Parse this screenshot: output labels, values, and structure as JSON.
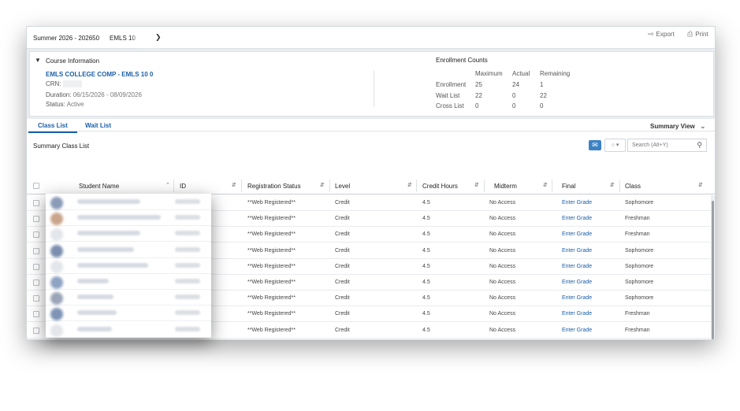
{
  "topbar": {
    "term": "Summer 2026 - 202650",
    "course": "EMLS 10",
    "export_label": "Export",
    "print_label": "Print"
  },
  "course_info": {
    "heading": "Course Information",
    "course_title": "EMLS COLLEGE COMP - EMLS 10 0",
    "crn_label": "CRN:",
    "duration_label": "Duration:",
    "duration_value": "06/15/2026 - 08/09/2026",
    "status_label": "Status:",
    "status_value": "Active"
  },
  "enrollment": {
    "heading": "Enrollment Counts",
    "col_headers": [
      "Maximum",
      "Actual",
      "Remaining"
    ],
    "rows": [
      {
        "label": "Enrollment",
        "values": [
          "25",
          "24",
          "1"
        ]
      },
      {
        "label": "Wait List",
        "values": [
          "22",
          "0",
          "22"
        ]
      },
      {
        "label": "Cross List",
        "values": [
          "0",
          "0",
          "0"
        ]
      }
    ]
  },
  "tabs": {
    "class_list": "Class List",
    "wait_list": "Wait List",
    "summary_view": "Summary View"
  },
  "toolbar": {
    "section_title": "Summary Class List",
    "search_placeholder": "Search (Alt+Y)"
  },
  "table": {
    "headers": [
      "Student Name",
      "ID",
      "Registration Status",
      "Level",
      "Credit Hours",
      "Midterm",
      "Final",
      "Class"
    ],
    "rows": [
      {
        "status": "**Web Registered**",
        "level": "Credit",
        "hours": "4.5",
        "midterm": "No Access",
        "final": "Enter Grade",
        "class": "Sophomore"
      },
      {
        "status": "**Web Registered**",
        "level": "Credit",
        "hours": "4.5",
        "midterm": "No Access",
        "final": "Enter Grade",
        "class": "Freshman"
      },
      {
        "status": "**Web Registered**",
        "level": "Credit",
        "hours": "4.5",
        "midterm": "No Access",
        "final": "Enter Grade",
        "class": "Freshman"
      },
      {
        "status": "**Web Registered**",
        "level": "Credit",
        "hours": "4.5",
        "midterm": "No Access",
        "final": "Enter Grade",
        "class": "Sophomore"
      },
      {
        "status": "**Web Registered**",
        "level": "Credit",
        "hours": "4.5",
        "midterm": "No Access",
        "final": "Enter Grade",
        "class": "Sophomore"
      },
      {
        "status": "**Web Registered**",
        "level": "Credit",
        "hours": "4.5",
        "midterm": "No Access",
        "final": "Enter Grade",
        "class": "Sophomore"
      },
      {
        "status": "**Web Registered**",
        "level": "Credit",
        "hours": "4.5",
        "midterm": "No Access",
        "final": "Enter Grade",
        "class": "Sophomore"
      },
      {
        "status": "**Web Registered**",
        "level": "Credit",
        "hours": "4.5",
        "midterm": "No Access",
        "final": "Enter Grade",
        "class": "Freshman"
      },
      {
        "status": "**Web Registered**",
        "level": "Credit",
        "hours": "4.5",
        "midterm": "No Access",
        "final": "Enter Grade",
        "class": "Freshman"
      }
    ]
  },
  "colors": {
    "link": "#1a5fa8",
    "accent_button": "#3b82c4"
  }
}
